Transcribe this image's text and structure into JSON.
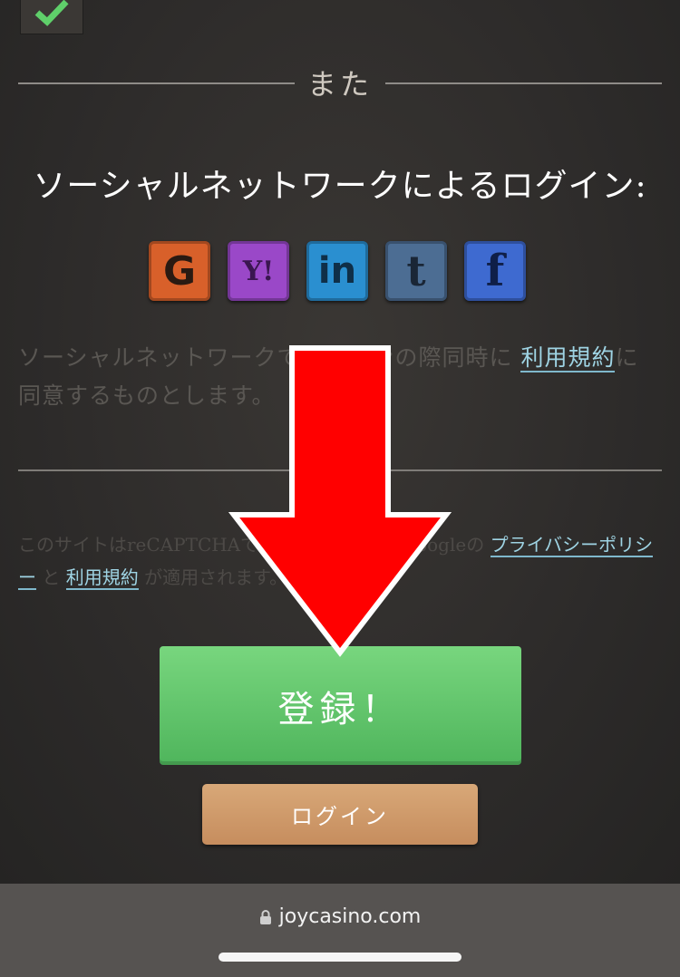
{
  "divider": {
    "text": "また"
  },
  "social": {
    "title": "ソーシャルネットワークによるログイン:",
    "networks": [
      {
        "name": "Google",
        "glyph": "G",
        "color": "#d8602a"
      },
      {
        "name": "Yahoo",
        "glyph": "Y!",
        "color": "#9a48c8"
      },
      {
        "name": "LinkedIn",
        "glyph": "in",
        "color": "#2a8fd0"
      },
      {
        "name": "Tumblr",
        "glyph": "t",
        "color": "#4c6d93"
      },
      {
        "name": "Facebook",
        "glyph": "f",
        "color": "#3e6ad0"
      }
    ],
    "consent_text_1": "ソーシャルネットワークでログインの際同時に ",
    "consent_link": "利用規約",
    "consent_text_2": "に同意するものとします。"
  },
  "recaptcha": {
    "text_1": "このサイトはreCAPTCHAで保護されており、Googleの ",
    "privacy_link": "プライバシーポリシー",
    "and": " と ",
    "terms_link": "利用規約",
    "text_2": " が適用されます。"
  },
  "buttons": {
    "register": "登録！",
    "login": "ログイン"
  },
  "browser": {
    "url": "joycasino.com",
    "lock_icon": "lock-icon"
  },
  "overlay": {
    "arrow_color": "#ff0000",
    "arrow_direction": "down"
  }
}
